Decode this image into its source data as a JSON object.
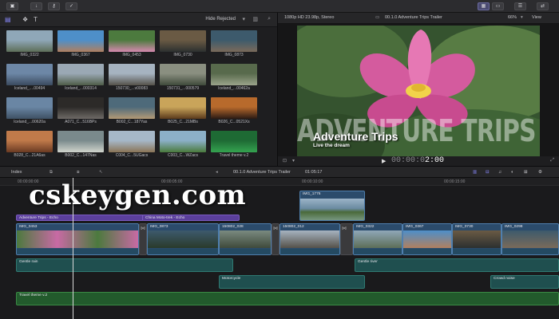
{
  "toolbar": {
    "buttons": [
      "▣",
      "↓",
      "⚷",
      "✓"
    ],
    "right_buttons": [
      "▦",
      "▭",
      "☰",
      "⇄"
    ]
  },
  "browser": {
    "filter": "Hide Rejected",
    "clips": [
      {
        "name": "IMG_0322",
        "c1": "#8fa7b8",
        "c2": "#5d6e58"
      },
      {
        "name": "IMG_0367",
        "c1": "#4e8fc9",
        "c2": "#b08060"
      },
      {
        "name": "IMG_0453",
        "c1": "#4c7a3e",
        "c2": "#d689b0"
      },
      {
        "name": "IMG_0730",
        "c1": "#6a5a44",
        "c2": "#2c3030"
      },
      {
        "name": "IMG_0873",
        "c1": "#3d5a6c",
        "c2": "#7a6a5a"
      },
      {
        "name": "Iceland_....00494",
        "c1": "#6d87a6",
        "c2": "#3a4a5e"
      },
      {
        "name": "Iceland_...000314",
        "c1": "#9aa8b4",
        "c2": "#4f5d48"
      },
      {
        "name": "150730_...v00083",
        "c1": "#a6b3c0",
        "c2": "#55524a"
      },
      {
        "name": "150731_...000579",
        "c1": "#8a8f80",
        "c2": "#3f4a3b"
      },
      {
        "name": "Iceland_...00462a",
        "c1": "#586a4c",
        "c2": "#9aa38a"
      },
      {
        "name": "Iceland_...00620a",
        "c1": "#6a86a4",
        "c2": "#3e5064"
      },
      {
        "name": "A071_C...516BPs",
        "c1": "#2c2a28",
        "c2": "#6e6a66"
      },
      {
        "name": "B002_C...187Yas",
        "c1": "#4e6a7a",
        "c2": "#b39a76"
      },
      {
        "name": "B025_C...21MBs",
        "c1": "#c9a45a",
        "c2": "#5a3a1c"
      },
      {
        "name": "B026_C...0521Xs",
        "c1": "#b86a2c",
        "c2": "#2a1a14"
      },
      {
        "name": "B028_C...21A6as",
        "c1": "#c07a4a",
        "c2": "#6a3a22"
      },
      {
        "name": "B002_C...147Nas",
        "c1": "#7a8a8c",
        "c2": "#d0d4cc"
      },
      {
        "name": "C004_C...5UGacs",
        "c1": "#a6b8c8",
        "c2": "#8a7456"
      },
      {
        "name": "C003_C...WZacs",
        "c1": "#8cb0c8",
        "c2": "#4a7a3c"
      },
      {
        "name": "Travel theme v.2",
        "c1": "#1e6a34",
        "c2": "#35a350"
      }
    ]
  },
  "viewer": {
    "format": "1080p HD 23.98p, Stereo",
    "project": "00.1.0 Adventure Trips Trailer",
    "zoom": "66%",
    "view_label": "View",
    "overlay_big": "ADVENTURE TRIPS",
    "overlay_title": "Adventure Trips",
    "overlay_subtitle": "Live the dream",
    "timecode_dim": "00:00:0",
    "timecode_bright": "2:00"
  },
  "timeline_bar": {
    "index": "Index",
    "project": "00.1.0 Adventure Trips Trailer",
    "duration": "01:05:17"
  },
  "ruler": [
    "00:00:00:00",
    "00:00:05:00",
    "00:00:10:00",
    "00:00:15:00"
  ],
  "tracks": {
    "connected_top": "IMG_1776",
    "purple1": "Adventure Trips - Echo",
    "purple2": "China Moto-trek - Echo",
    "primary": [
      "IMG_0453",
      "IMG_0873",
      "150802_028",
      "150802_012",
      "IMG_0322",
      "IMG_0367",
      "IMG_0730",
      "IMG_0298"
    ],
    "audio1": "Gentle rain",
    "audio2": "Gentle river",
    "audio3": "Motorcycle",
    "audio4": "Crowd noise",
    "music": "Travel theme v.2"
  },
  "watermark": "cskeygen.com",
  "colors": {
    "accent": "#5b3f9c",
    "video": "#2b4b6b",
    "audio": "#1f4f4f",
    "music": "#225a2c"
  }
}
